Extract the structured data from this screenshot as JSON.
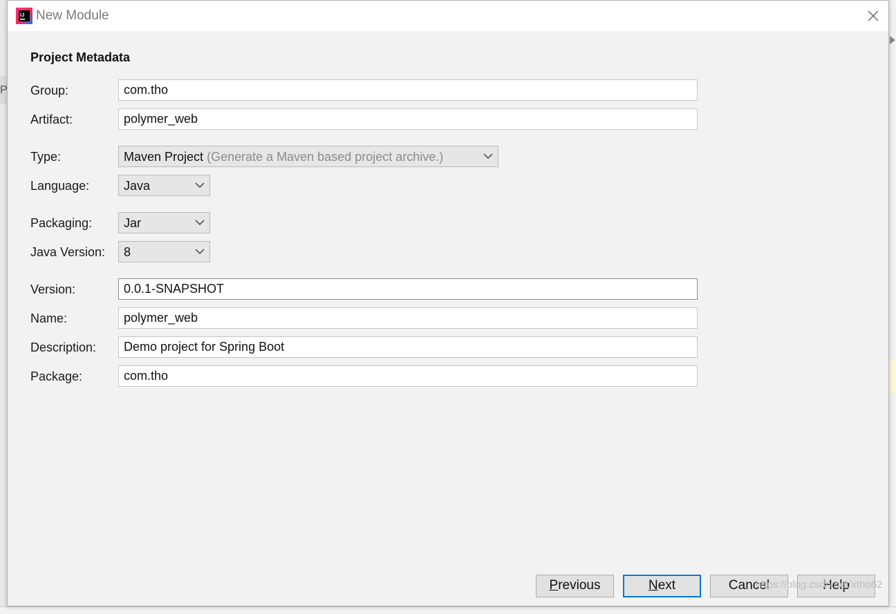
{
  "window": {
    "title": "New Module",
    "app_icon": "intellij-idea-icon"
  },
  "background": {
    "left_fragment": "P"
  },
  "form": {
    "section_title": "Project Metadata",
    "group": {
      "label": "Group:",
      "value": "com.tho"
    },
    "artifact": {
      "label": "Artifact:",
      "value": "polymer_web"
    },
    "type": {
      "label": "Type:",
      "value": "Maven Project",
      "hint": "(Generate a Maven based project archive.)"
    },
    "language": {
      "label": "Language:",
      "value": "Java"
    },
    "packaging": {
      "label": "Packaging:",
      "value": "Jar"
    },
    "java_version": {
      "label": "Java Version:",
      "value": "8"
    },
    "version": {
      "label": "Version:",
      "value": "0.0.1-SNAPSHOT"
    },
    "name": {
      "label": "Name:",
      "value": "polymer_web"
    },
    "description": {
      "label": "Description:",
      "value": "Demo project for Spring Boot"
    },
    "package": {
      "label": "Package:",
      "value": "com.tho"
    }
  },
  "buttons": {
    "previous": {
      "mnemonic": "P",
      "rest": "revious"
    },
    "next": {
      "mnemonic": "N",
      "rest": "ext"
    },
    "cancel": "Cancel",
    "help": "Help"
  },
  "watermark": "https://blog.csdn.net/xtho62",
  "colors": {
    "default_button_border": "#0078d7",
    "dialog_bg": "#f2f2f2"
  }
}
